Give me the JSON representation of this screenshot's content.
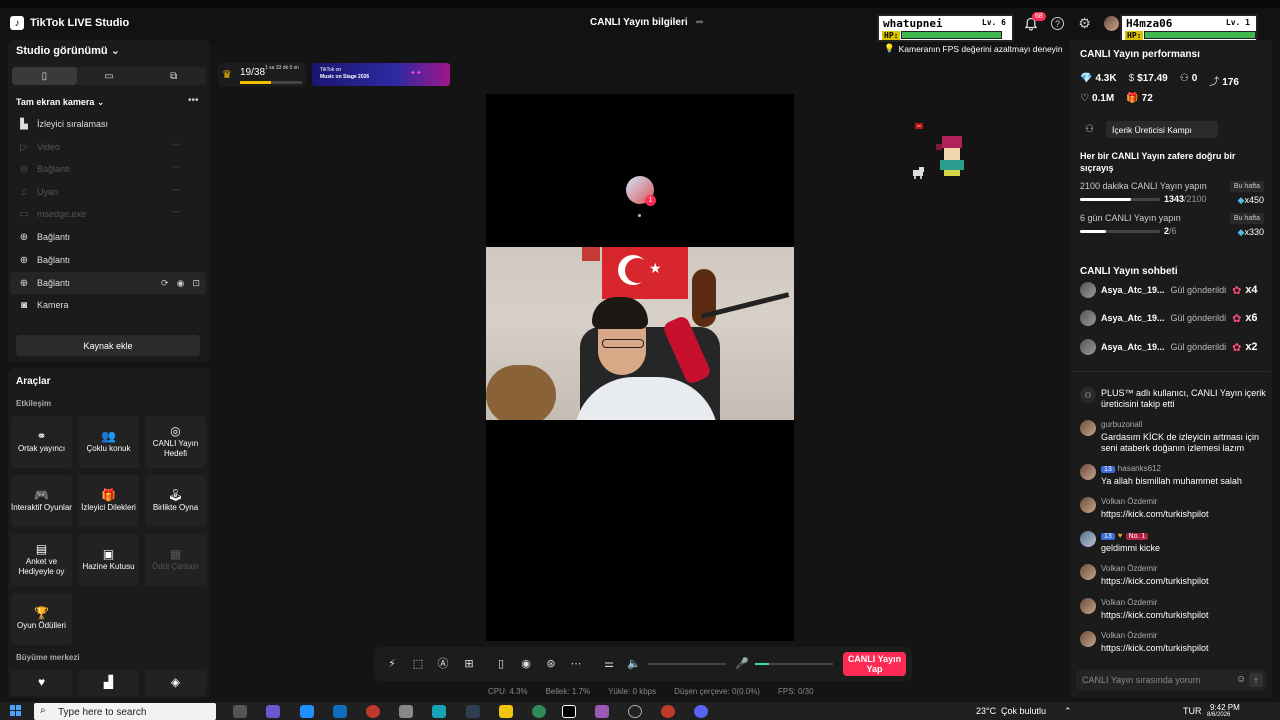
{
  "app": {
    "title": "TikTok LIVE Studio",
    "logo_glyph": "♪"
  },
  "header": {
    "stream_info": "CANLI Yayın bilgileri",
    "notifications": "68"
  },
  "game_players": [
    {
      "name": "whatupnei",
      "level": "Lv. 6",
      "hp_label": "HP:",
      "hp": 0.88
    },
    {
      "name": "H4mza06",
      "level": "Lv. 1",
      "hp_label": "HP:",
      "hp": 0.98
    }
  ],
  "tip": "Kameranın FPS değerini azaltmayı deneyin",
  "sidebar": {
    "studio_view": "Studio görünümü",
    "scene": "Tam ekran kamera",
    "sources": [
      {
        "label": "İzleyici sıralaması",
        "icon": "ranking-icon",
        "dim": false
      },
      {
        "label": "Video",
        "icon": "video-icon",
        "dim": true
      },
      {
        "label": "Bağlantı",
        "icon": "link-icon",
        "dim": true
      },
      {
        "label": "Uyarı",
        "icon": "bell-icon",
        "dim": true
      },
      {
        "label": "msedge.exe",
        "icon": "window-icon",
        "dim": true
      },
      {
        "label": "Bağlantı",
        "icon": "globe-icon",
        "dim": false
      },
      {
        "label": "Bağlantı",
        "icon": "globe-icon",
        "dim": false
      },
      {
        "label": "Bağlantı",
        "icon": "globe-icon",
        "dim": false
      },
      {
        "label": "Kamera",
        "icon": "camera-icon",
        "dim": false
      }
    ],
    "add_source": "Kaynak ekle"
  },
  "tools": {
    "title": "Araçlar",
    "interaction": "Etkileşim",
    "items": [
      {
        "label": "Ortak yayıncı"
      },
      {
        "label": "Çoklu konuk"
      },
      {
        "label": "CANLI Yayın Hedefi"
      },
      {
        "label": "İnteraktif Oyunlar"
      },
      {
        "label": "İzleyici Dilekleri"
      },
      {
        "label": "Birlikte Oyna"
      },
      {
        "label": "Anket ve Hediyeyle oy"
      },
      {
        "label": "Hazine Kutusu"
      },
      {
        "label": "Ödül Çantası"
      },
      {
        "label": "Oyun Ödülleri"
      }
    ],
    "growth": "Büyüme merkezi"
  },
  "overlay": {
    "goal_count": "19/38",
    "goal_time": "1 sa 33 dk 0 sn",
    "goal_progress": 0.5,
    "banner_line1": "TikTok on",
    "banner_line2": "Music on Stage 2026"
  },
  "toolbar": {
    "go_live": "CANLI Yayın Yap",
    "volume_level": 0.0,
    "mic_level": 0.18
  },
  "stats": [
    {
      "label": "CPU:",
      "value": "4.3%"
    },
    {
      "label": "Bellek:",
      "value": "1.7%"
    },
    {
      "label": "Yükle:",
      "value": "0 kbps"
    },
    {
      "label": "Düşen çerçeve:",
      "value": "0(0.0%)"
    },
    {
      "label": "FPS:",
      "value": "0/30"
    }
  ],
  "performance": {
    "title": "CANLI Yayın performansı",
    "diamonds": "4.3K",
    "earnings": "$17.49",
    "new_followers": "0",
    "shares": "176",
    "likes": "0.1M",
    "gifts": "72"
  },
  "campaign": {
    "chip": "İçerik Üreticisi Kampı",
    "text": "Her bir CANLI Yayın zafere doğru bir sıçrayış",
    "tasks": [
      {
        "title": "2100 dakika CANLI Yayın yapın",
        "badge": "Bu hafta",
        "progress": "1343",
        "total": "/2100",
        "fraction": 0.64,
        "reward": "x450"
      },
      {
        "title": "6 gün CANLI Yayın yapın",
        "badge": "Bu hafta",
        "progress": "2",
        "total": "/6",
        "fraction": 0.33,
        "reward": "x330"
      }
    ]
  },
  "chat": {
    "title": "CANLI Yayın sohbeti",
    "gifts": [
      {
        "user": "Asya_Atc_19...",
        "action": "Gül gönderildi",
        "count": "x4"
      },
      {
        "user": "Asya_Atc_19...",
        "action": "Gül gönderildi",
        "count": "x6"
      },
      {
        "user": "Asya_Atc_19...",
        "action": "Gül gönderildi",
        "count": "x2"
      }
    ],
    "messages": [
      {
        "user": "",
        "text": "PLUS™ adlı kullanıcı, CANLI Yayın içerik üreticisini takip etti"
      },
      {
        "user": "gurbuzonall",
        "text": "Gardasım KİCK de izleyicin artması için seni ataberk doğanın izlemesi lazım"
      },
      {
        "user": "hasanks612",
        "level": "13",
        "text": "Ya allah bismillah muhammet salah"
      },
      {
        "user": "Volkan Özdemir",
        "text": "https://kick.com/turkishpilot"
      },
      {
        "user": "",
        "level": "13",
        "rank": "No. 1",
        "text": "geldimmi kicke"
      },
      {
        "user": "Volkan Özdemir",
        "text": "https://kick.com/turkishpilot"
      },
      {
        "user": "Volkan Özdemir",
        "text": "https://kick.com/turkishpilot"
      },
      {
        "user": "Volkan Özdemir",
        "text": "https://kick.com/turkishpilot"
      }
    ],
    "input_placeholder": "CANLI Yayın sırasında yorum"
  },
  "taskbar": {
    "search_placeholder": "Type here to search",
    "weather": "23°C",
    "weather_text": "Çok bulutlu",
    "lang": "TUR",
    "time": "9:42 PM",
    "date": "8/6/2026"
  }
}
